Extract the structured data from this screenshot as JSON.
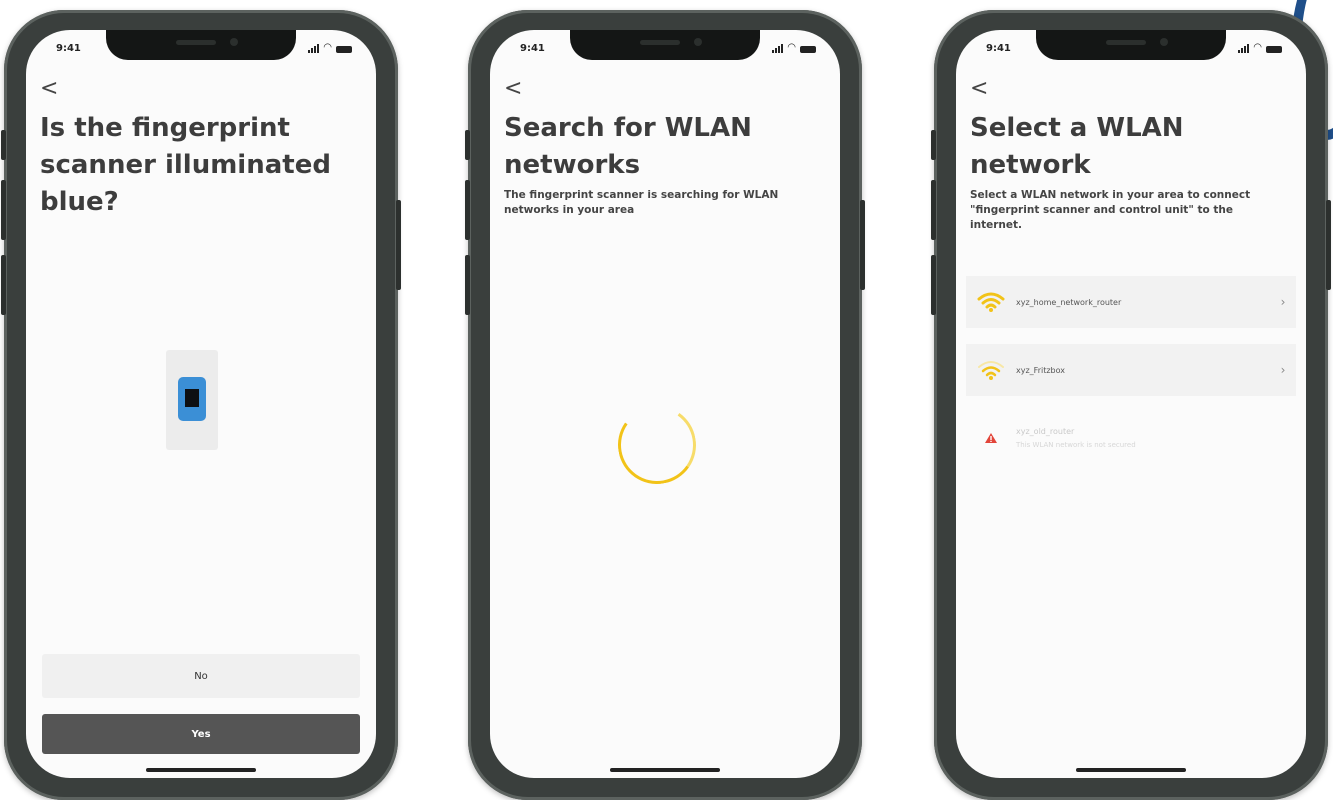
{
  "colors": {
    "accent": "#f2c318",
    "sensor": "#3b8fd6",
    "primary_button": "#555555",
    "warning": "#e2453a"
  },
  "status": {
    "time": "9:41"
  },
  "back_label": "<",
  "screen1": {
    "title": "Is the fingerprint scanner illuminated blue?",
    "no_label": "No",
    "yes_label": "Yes"
  },
  "screen2": {
    "title": "Search for WLAN networks",
    "subtitle": "The fingerprint scanner is searching for WLAN networks in your area"
  },
  "screen3": {
    "title": "Select a WLAN network",
    "subtitle": "Select a WLAN network in your area to connect \"fingerprint scanner and control unit\" to the internet.",
    "networks": [
      {
        "name": "xyz_home_network_router",
        "icon": "wifi-strong-icon",
        "chevron": "›"
      },
      {
        "name": "xyz_Fritzbox",
        "icon": "wifi-weak-icon",
        "chevron": "›"
      },
      {
        "name": "xyz_old_router",
        "icon": "warning-icon",
        "note": "This WLAN network is not secured"
      }
    ]
  }
}
